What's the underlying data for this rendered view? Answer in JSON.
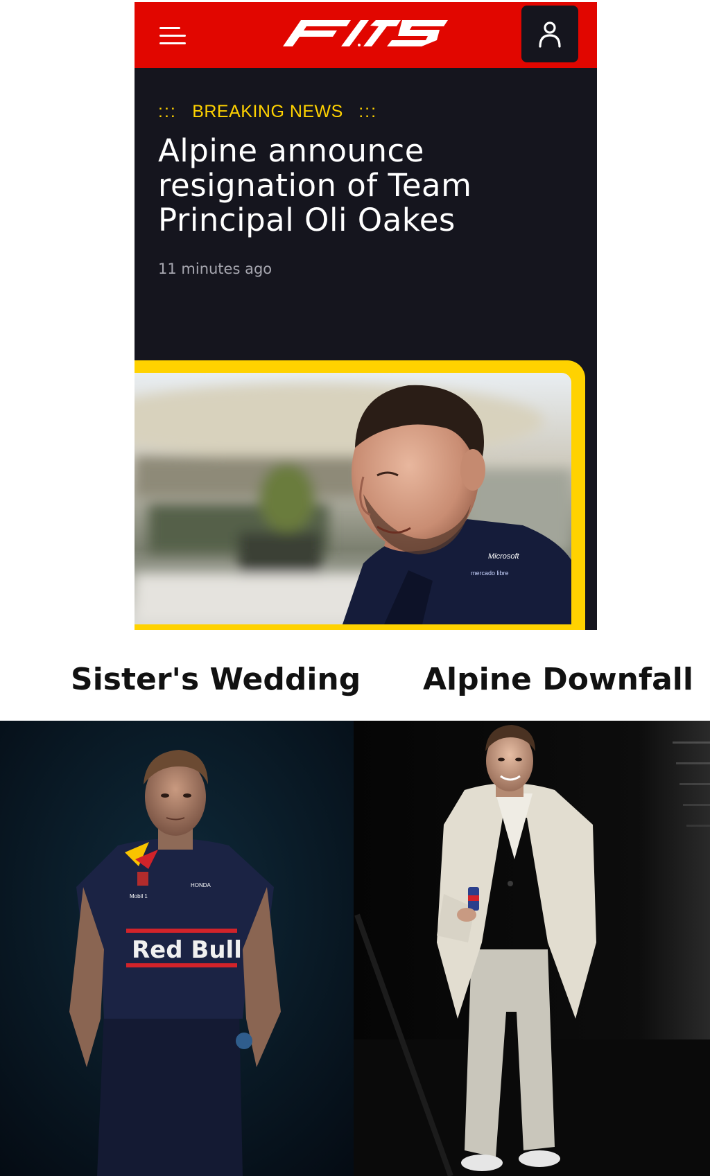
{
  "app": {
    "menu_icon": "hamburger-menu-icon",
    "logo_icon": "f1-75-logo-icon",
    "account_icon": "user-account-icon",
    "brand_red": "#e10600",
    "background": "#15151e",
    "accent_yellow": "#ffd200"
  },
  "article": {
    "dots_left": ":::",
    "label": "BREAKING NEWS",
    "dots_right": ":::",
    "headline": "Alpine announce resignation of Team Principal Oli Oakes",
    "timestamp": "11 minutes ago"
  },
  "meme": {
    "left_caption": "Sister's Wedding",
    "right_caption": "Alpine Downfall",
    "left_shirt_text": "Red Bull"
  }
}
